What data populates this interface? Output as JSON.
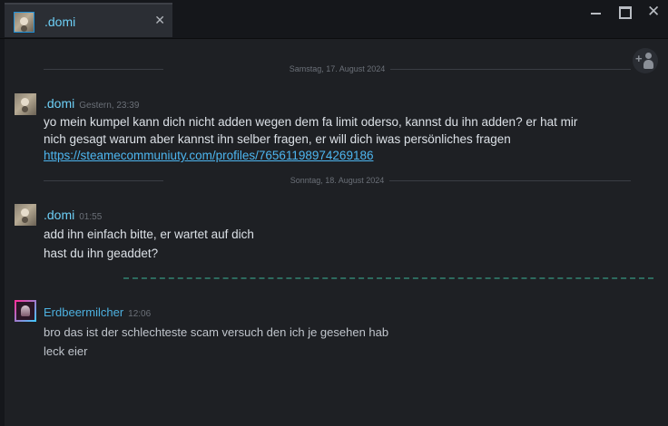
{
  "tab": {
    "title": ".domi",
    "close_glyph": "✕"
  },
  "window_controls": {
    "minimize_icon": "minimize-icon",
    "maximize_icon": "maximize-icon",
    "close_glyph": "✕"
  },
  "add_friend": {
    "icon": "add-friend-icon",
    "plus": "+"
  },
  "date_separators": [
    "Samstag, 17. August 2024",
    "Sonntag, 18. August 2024"
  ],
  "messages": [
    {
      "author": ".domi",
      "time": "Gestern, 23:39",
      "lines": [
        "yo mein kumpel kann dich nicht adden wegen dem fa limit oderso, kannst du ihn adden? er hat mir",
        "nich gesagt warum aber kannst ihn selber fragen, er will dich iwas persönliches fragen"
      ],
      "link": "https://steamecommuniuty.com/profiles/76561198974269186"
    },
    {
      "author": ".domi",
      "time": "01:55",
      "lines": [
        "add ihn einfach bitte, er wartet auf dich",
        "hast du ihn geaddet?"
      ]
    },
    {
      "author": "Erdbeermilcher",
      "time": "12:06",
      "lines": [
        "bro das ist der schlechteste scam versuch den ich je gesehen hab",
        "leck eier"
      ]
    }
  ],
  "colors": {
    "accent": "#6dcff6",
    "link": "#4db6f0",
    "background": "#1e2024",
    "text": "#dbe0e6"
  }
}
